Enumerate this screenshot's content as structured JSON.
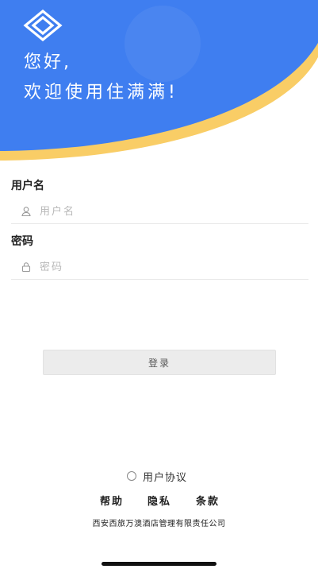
{
  "header": {
    "greeting": "您好,",
    "welcome": "欢迎使用住满满!",
    "colors": {
      "primary": "#3f7ef0",
      "accent": "#f9cd66"
    },
    "logo_icon": "diamond-logo-icon"
  },
  "form": {
    "username": {
      "label": "用户名",
      "placeholder": "用户名",
      "value": "",
      "icon": "user-icon"
    },
    "password": {
      "label": "密码",
      "placeholder": "密码",
      "value": "",
      "icon": "lock-icon"
    },
    "login_label": "登录"
  },
  "agreement": {
    "label": "用户协议",
    "checked": false
  },
  "footer_links": {
    "help": "帮助",
    "privacy": "隐私",
    "terms": "条款"
  },
  "company": "西安西旅万澳酒店管理有限责任公司"
}
